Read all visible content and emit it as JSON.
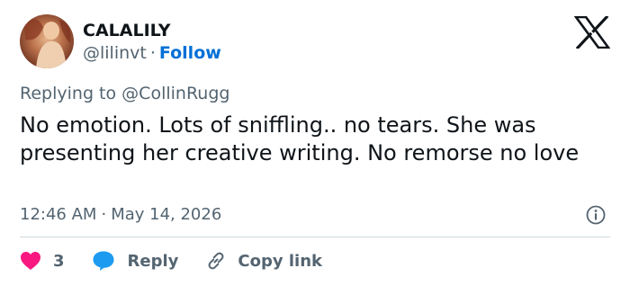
{
  "author": {
    "display_name": "CALALILY",
    "handle": "@lilinvt",
    "separator": "·",
    "follow_label": "Follow"
  },
  "reply_context": {
    "prefix": "Replying to",
    "mention": "@CollinRugg"
  },
  "tweet": {
    "text": "No emotion. Lots of sniffling.. no tears. She was presenting her creative writing. No remorse no love"
  },
  "meta": {
    "time": "12:46 AM",
    "separator": "·",
    "date": "May 14, 2026"
  },
  "actions": {
    "like_count": "3",
    "reply_label": "Reply",
    "copy_link_label": "Copy link"
  },
  "icons": {
    "brand": "x-logo-icon",
    "like": "heart-icon",
    "reply": "speech-bubble-icon",
    "copy": "link-icon",
    "info": "info-icon"
  },
  "colors": {
    "link_blue": "#006fd6",
    "like_pink": "#f91880",
    "reply_blue": "#1d9bf0",
    "secondary_text": "#536471",
    "primary_text": "#0f1419",
    "divider": "#cfd9de"
  }
}
